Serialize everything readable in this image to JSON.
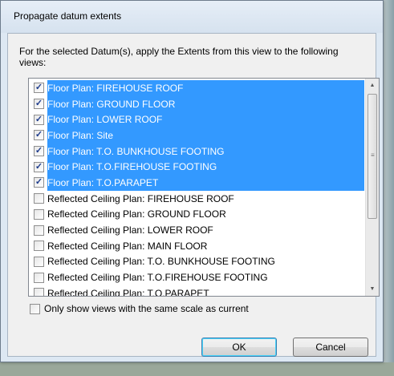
{
  "dialog": {
    "title": "Propagate datum extents",
    "instructions": "For the selected Datum(s), apply the Extents from this view to the following views:",
    "views": [
      {
        "label": "Floor Plan: FIREHOUSE ROOF",
        "checked": true,
        "selected": true
      },
      {
        "label": "Floor Plan: GROUND FLOOR",
        "checked": true,
        "selected": true
      },
      {
        "label": "Floor Plan: LOWER ROOF",
        "checked": true,
        "selected": true
      },
      {
        "label": "Floor Plan: Site",
        "checked": true,
        "selected": true
      },
      {
        "label": "Floor Plan: T.O. BUNKHOUSE FOOTING",
        "checked": true,
        "selected": true
      },
      {
        "label": "Floor Plan: T.O.FIREHOUSE FOOTING",
        "checked": true,
        "selected": true
      },
      {
        "label": "Floor Plan: T.O.PARAPET",
        "checked": true,
        "selected": true
      },
      {
        "label": "Reflected Ceiling Plan: FIREHOUSE ROOF",
        "checked": false,
        "selected": false
      },
      {
        "label": "Reflected Ceiling Plan: GROUND FLOOR",
        "checked": false,
        "selected": false
      },
      {
        "label": "Reflected Ceiling Plan: LOWER ROOF",
        "checked": false,
        "selected": false
      },
      {
        "label": "Reflected Ceiling Plan: MAIN FLOOR",
        "checked": false,
        "selected": false
      },
      {
        "label": "Reflected Ceiling Plan: T.O. BUNKHOUSE FOOTING",
        "checked": false,
        "selected": false
      },
      {
        "label": "Reflected Ceiling Plan: T.O.FIREHOUSE FOOTING",
        "checked": false,
        "selected": false
      },
      {
        "label": "Reflected Ceiling Plan: T.O.PARAPET",
        "checked": false,
        "selected": false
      }
    ],
    "same_scale_filter": {
      "label": "Only show views with the same scale as current",
      "checked": false
    },
    "ok_label": "OK",
    "cancel_label": "Cancel",
    "check_glyph": "✓",
    "icons": {
      "scroll_up": "scroll-up-arrow-icon",
      "scroll_down": "scroll-down-arrow-icon"
    },
    "colors": {
      "selection": "#3399ff",
      "dialog_frame": "#dde8f3"
    }
  }
}
